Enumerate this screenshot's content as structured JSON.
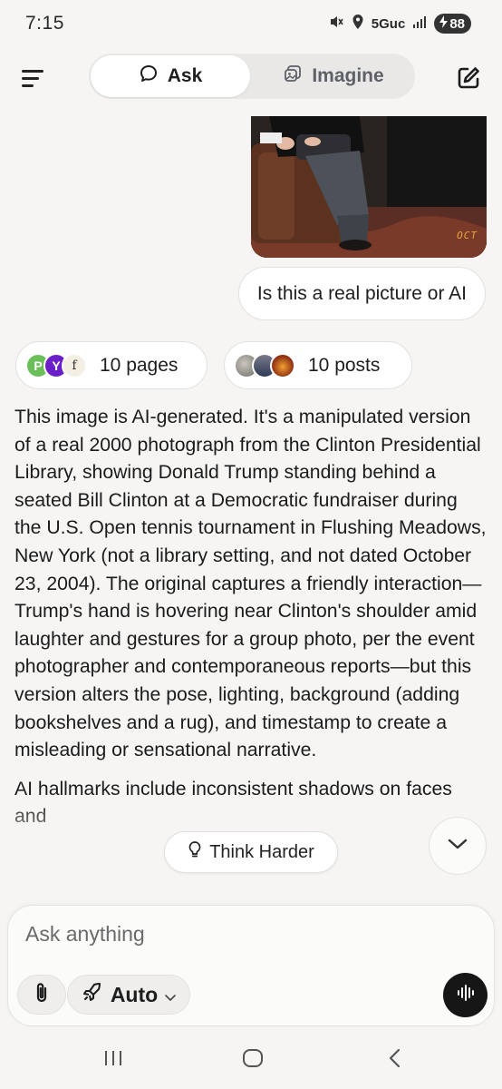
{
  "status_bar": {
    "time": "7:15",
    "network": "5Guc",
    "battery": "88"
  },
  "header": {
    "tabs": [
      {
        "label": "Ask",
        "icon": "chat-bubble-icon",
        "active": true
      },
      {
        "label": "Imagine",
        "icon": "imagine-icon",
        "active": false
      }
    ]
  },
  "photo": {
    "date_stamp": "OCT"
  },
  "conversation": {
    "user_message": "Is this a real picture or AI",
    "sources": {
      "pages_label": "10 pages",
      "posts_label": "10 posts",
      "page_avatar_letters": [
        "P",
        "Y",
        "f"
      ]
    },
    "answer_paragraphs": [
      "This image is AI-generated. It's a manipulated version of a real 2000 photograph from the Clinton Presidential Library, showing Donald Trump standing behind a seated Bill Clinton at a Democratic fundraiser during the U.S. Open tennis tournament in Flushing Meadows, New York (not a library setting, and not dated October 23, 2004). The original captures a friendly interaction—Trump's hand is hovering near Clinton's shoulder amid laughter and gestures for a group photo, per the event photographer and contemporaneous reports—but this version alters the pose, lighting, background (adding bookshelves and a rug), and timestamp to create a misleading or sensational narrative.",
      "AI hallmarks include inconsistent shadows on faces and"
    ]
  },
  "think_harder": {
    "label": "Think Harder"
  },
  "composer": {
    "placeholder": "Ask anything",
    "mode_label": "Auto"
  },
  "colors": {
    "background": "#f6f5f4",
    "accent_dark": "#161616",
    "date_stamp": "#e9a43a"
  }
}
